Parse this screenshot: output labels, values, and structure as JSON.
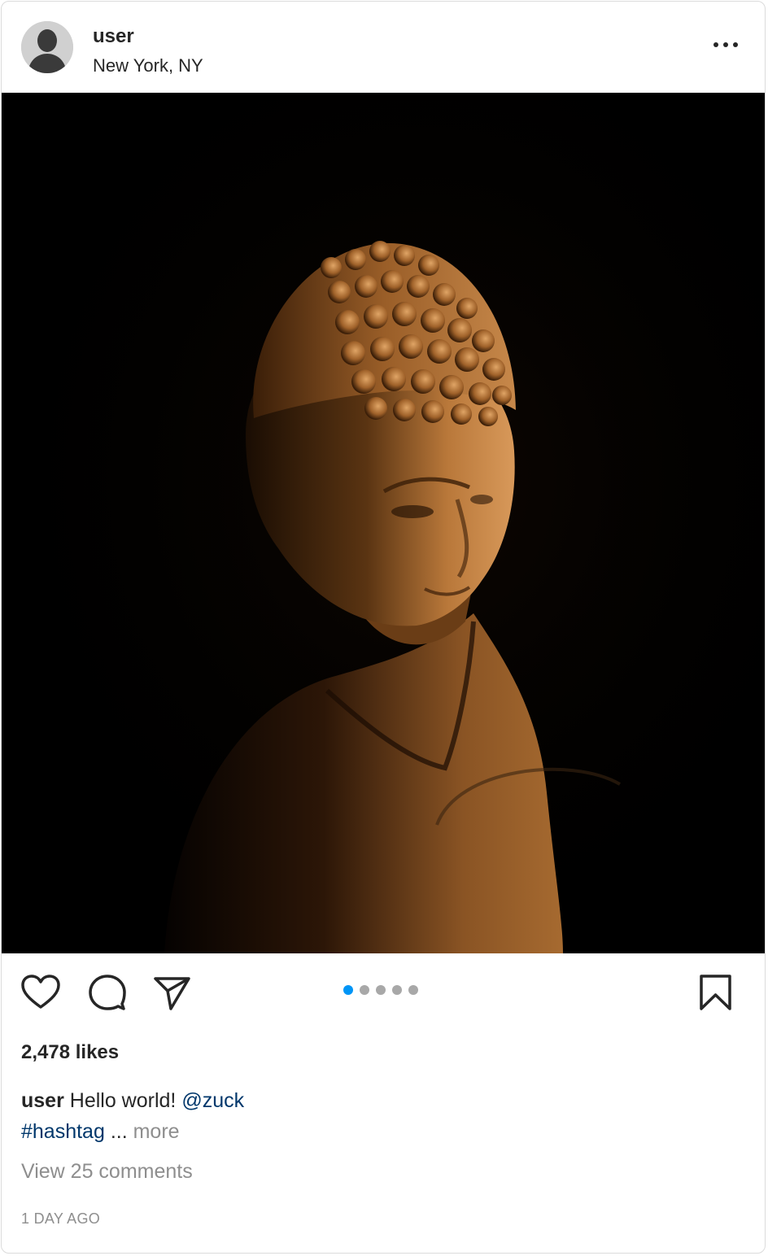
{
  "post": {
    "username": "user",
    "location": "New York, NY",
    "likes": "2,478 likes",
    "caption": {
      "username": "user",
      "text": " Hello world! ",
      "mention": "@zuck",
      "hashtag": "#hashtag",
      "ellipsis": " ... ",
      "more": "more"
    },
    "view_comments": "View 25 comments",
    "timestamp": "1 DAY AGO",
    "carousel": {
      "count": 5,
      "active_index": 0
    }
  },
  "icons": {
    "menu": "more-horizontal-icon",
    "like": "heart-icon",
    "comment": "comment-icon",
    "share": "send-icon",
    "save": "bookmark-icon"
  },
  "colors": {
    "accent": "#0095f6",
    "link": "#00376b",
    "muted": "#8e8e8e",
    "text": "#262626",
    "dot_inactive": "#a8a8a8"
  }
}
